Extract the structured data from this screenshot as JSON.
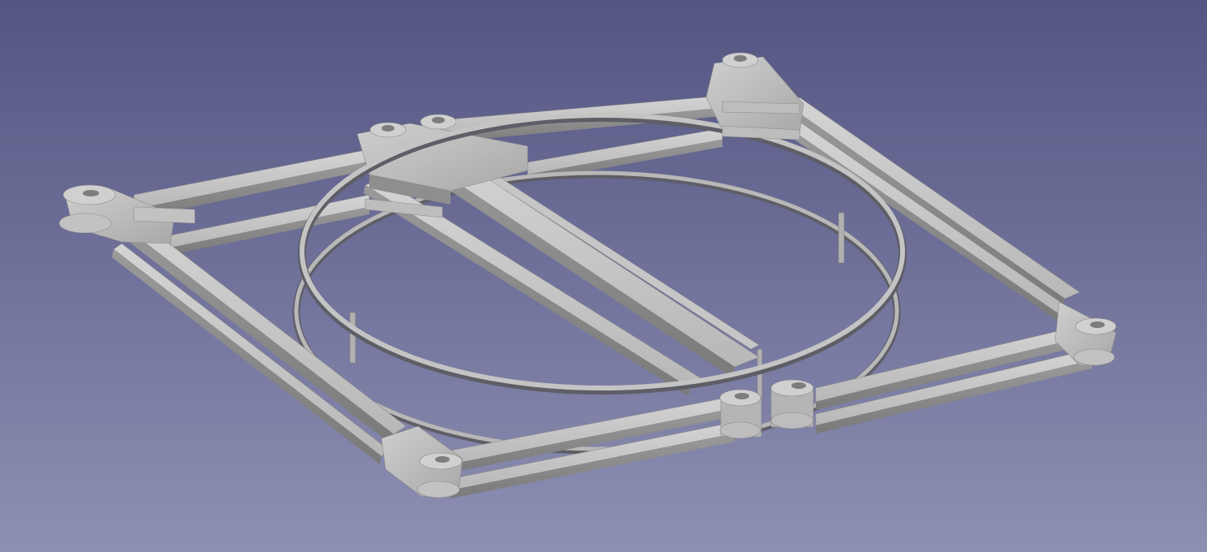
{
  "viewport": {
    "background_top": "#545582",
    "background_bottom": "#8d8fb3",
    "view": "axonometric"
  },
  "model": {
    "part_color_light": "#c8c8c8",
    "part_color_mid": "#a9a9a9",
    "part_color_dark": "#7d7d7d",
    "ring_color": "#b5b5b5",
    "ring_shadow": "#5e5e66"
  }
}
